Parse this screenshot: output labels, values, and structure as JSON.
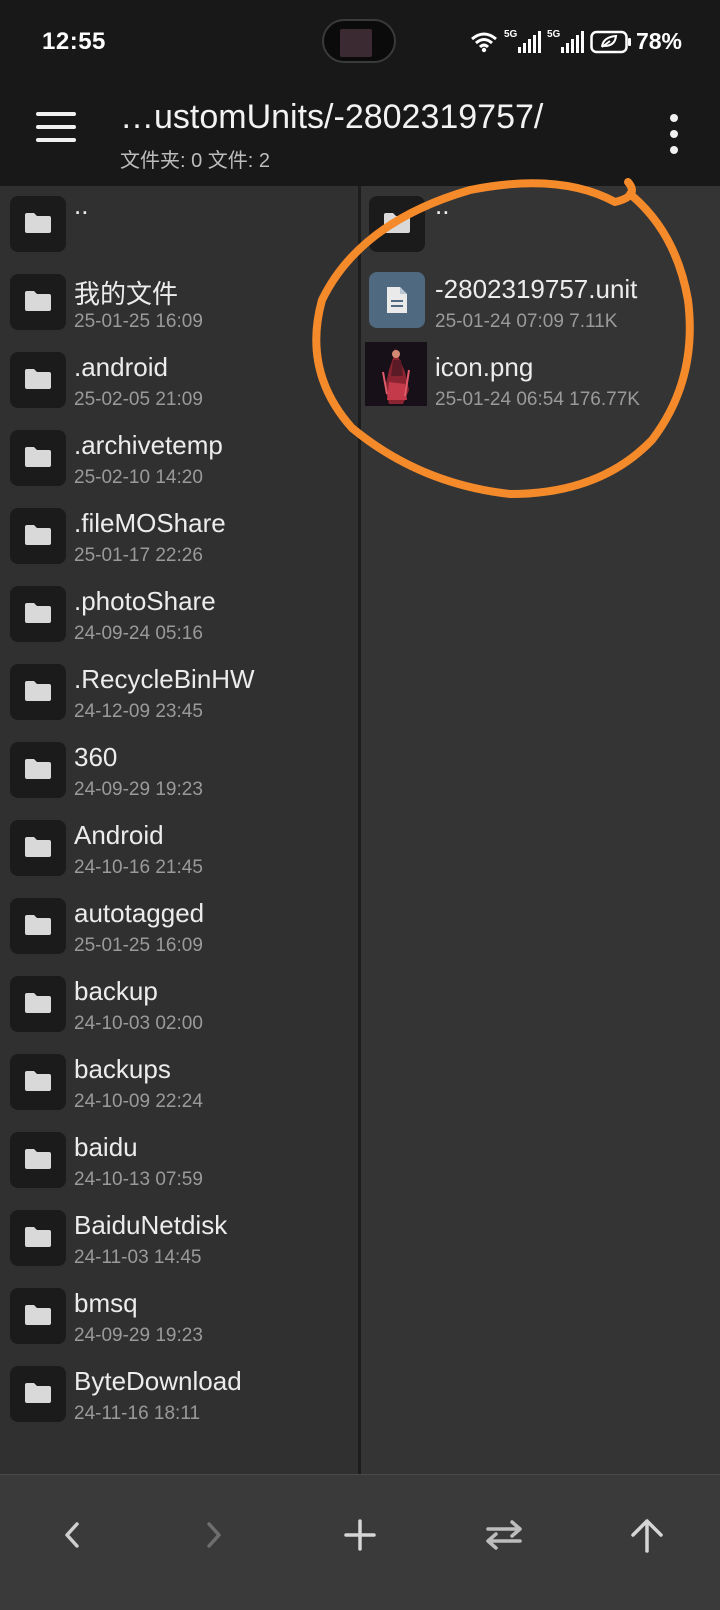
{
  "status": {
    "time": "12:55",
    "battery": "78%",
    "network_label_1": "5G",
    "network_label_2": "5G"
  },
  "toolbar": {
    "path": "…ustomUnits/-2802319757/",
    "summary": "文件夹: 0  文件: 2"
  },
  "left_pane": {
    "parent_label": "..",
    "items": [
      {
        "name": " 我的文件",
        "date": "25-01-25 16:09"
      },
      {
        "name": ".android",
        "date": "25-02-05 21:09"
      },
      {
        "name": ".archivetemp",
        "date": "25-02-10 14:20"
      },
      {
        "name": ".fileMOShare",
        "date": "25-01-17 22:26"
      },
      {
        "name": ".photoShare",
        "date": "24-09-24 05:16"
      },
      {
        "name": ".RecycleBinHW",
        "date": "24-12-09 23:45"
      },
      {
        "name": "360",
        "date": "24-09-29 19:23"
      },
      {
        "name": "Android",
        "date": "24-10-16 21:45"
      },
      {
        "name": "autotagged",
        "date": "25-01-25 16:09"
      },
      {
        "name": "backup",
        "date": "24-10-03 02:00"
      },
      {
        "name": "backups",
        "date": "24-10-09 22:24"
      },
      {
        "name": "baidu",
        "date": "24-10-13 07:59"
      },
      {
        "name": "BaiduNetdisk",
        "date": "24-11-03 14:45"
      },
      {
        "name": "bmsq",
        "date": "24-09-29 19:23"
      },
      {
        "name": "ByteDownload",
        "date": "24-11-16 18:11"
      }
    ]
  },
  "right_pane": {
    "parent_label": "..",
    "files": [
      {
        "name": "-2802319757.unit",
        "meta": "25-01-24 07:09  7.11K",
        "icon": "document-icon"
      },
      {
        "name": "icon.png",
        "meta": "25-01-24 06:54  176.77K",
        "icon": "image-thumbnail"
      }
    ]
  },
  "bottom_bar": {
    "buttons": [
      "back-icon",
      "forward-icon",
      "add-icon",
      "swap-icon",
      "up-icon"
    ]
  },
  "colors": {
    "annotation_circle": "#f58a2a",
    "file_icon_bg": "#4f6a80"
  }
}
